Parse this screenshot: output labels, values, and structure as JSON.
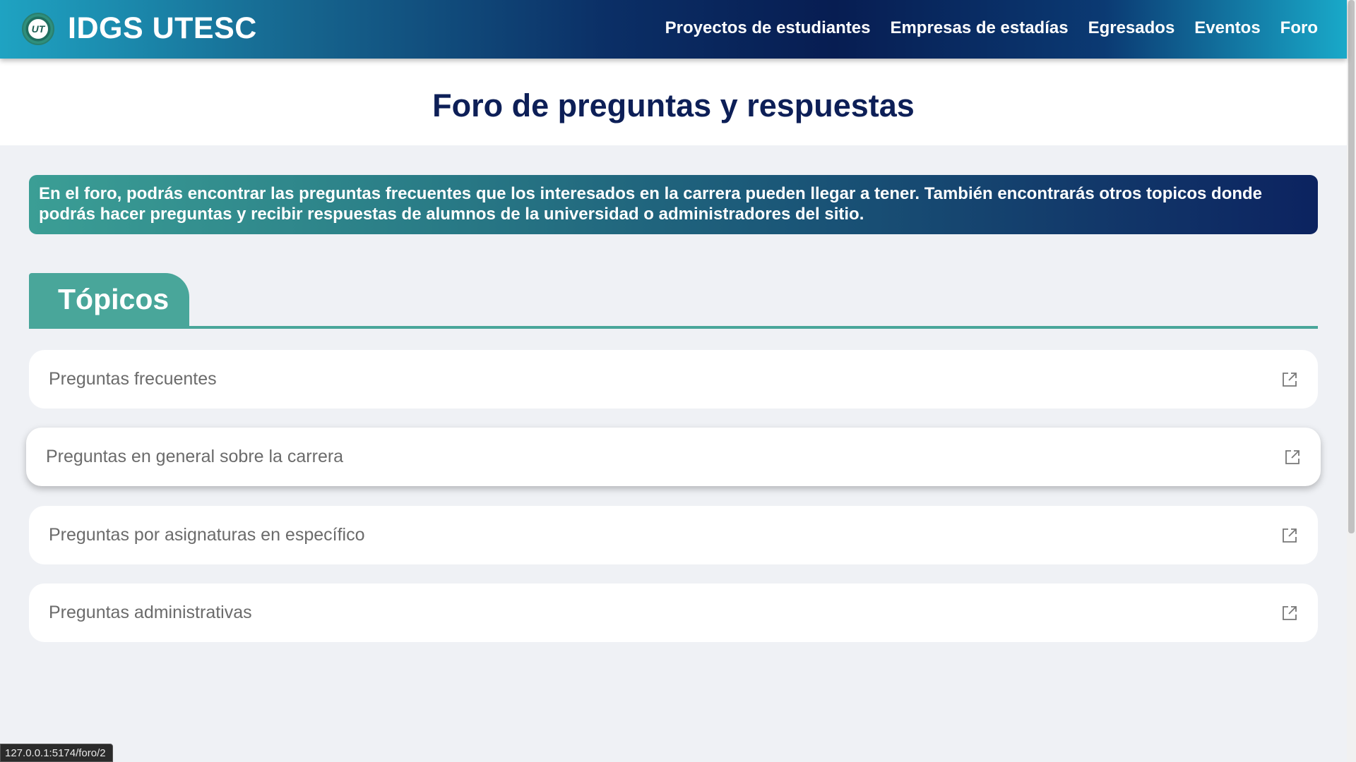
{
  "navbar": {
    "logo_text": "UT",
    "brand": "IDGS UTESC",
    "links": [
      {
        "label": "Proyectos de estudiantes"
      },
      {
        "label": "Empresas de estadías"
      },
      {
        "label": "Egresados"
      },
      {
        "label": "Eventos"
      },
      {
        "label": "Foro"
      }
    ]
  },
  "page": {
    "title": "Foro de preguntas y respuestas",
    "info": "En el foro, podrás encontrar las preguntas frecuentes que los interesados en la carrera pueden llegar a tener. También encontrarás otros topicos donde podrás hacer preguntas y recibir respuestas de alumnos de la universidad o administradores del sitio."
  },
  "topics": {
    "heading": "Tópicos",
    "items": [
      {
        "label": "Preguntas frecuentes",
        "icon": "external-link-icon"
      },
      {
        "label": "Preguntas en general sobre la carrera",
        "icon": "external-link-icon",
        "hovered": true
      },
      {
        "label": "Preguntas por asignaturas en específico",
        "icon": "external-link-icon"
      },
      {
        "label": "Preguntas administrativas",
        "icon": "external-link-icon"
      }
    ]
  },
  "status_bar": {
    "url": "127.0.0.1:5174/foro/2"
  },
  "colors": {
    "accent_teal": "#49a69a",
    "navy": "#0d1f57",
    "background": "#eff1f5"
  }
}
